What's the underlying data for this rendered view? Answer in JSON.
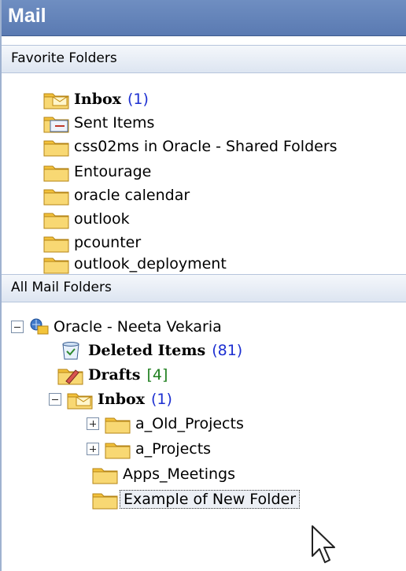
{
  "pane": {
    "title": "Mail"
  },
  "favorites": {
    "header": "Favorite Folders",
    "items": [
      {
        "label": "Inbox",
        "count": "(1)",
        "icon": "inbox-icon"
      },
      {
        "label": "Sent Items",
        "icon": "sent-items-icon"
      },
      {
        "label": "css02ms in Oracle - Shared Folders",
        "icon": "folder-icon"
      },
      {
        "label": "Entourage",
        "icon": "folder-icon"
      },
      {
        "label": "oracle calendar",
        "icon": "folder-icon"
      },
      {
        "label": "outlook",
        "icon": "folder-icon"
      },
      {
        "label": "pcounter",
        "icon": "folder-icon"
      },
      {
        "label": "outlook_deployment",
        "icon": "folder-icon"
      }
    ]
  },
  "all_folders": {
    "header": "All Mail Folders",
    "root": {
      "label": "Oracle  -  Neeta Vekaria",
      "icon": "mailbox-icon"
    },
    "deleted": {
      "label": "Deleted Items",
      "count": "(81)",
      "icon": "deleted-items-icon"
    },
    "drafts": {
      "label": "Drafts",
      "count": "[4]",
      "icon": "drafts-icon"
    },
    "inbox": {
      "label": "Inbox",
      "count": "(1)",
      "icon": "inbox-icon"
    },
    "children": [
      {
        "label": "a_Old_Projects",
        "icon": "folder-icon"
      },
      {
        "label": "a_Projects",
        "icon": "folder-icon"
      },
      {
        "label": "Apps_Meetings",
        "icon": "folder-icon"
      },
      {
        "label": "Example of New Folder",
        "icon": "folder-icon"
      }
    ]
  },
  "colors": {
    "header_blue": "#6f8ec1",
    "count_blue": "#1c2fd1",
    "count_green": "#208020",
    "folder_yellow": "#f3c43a"
  }
}
